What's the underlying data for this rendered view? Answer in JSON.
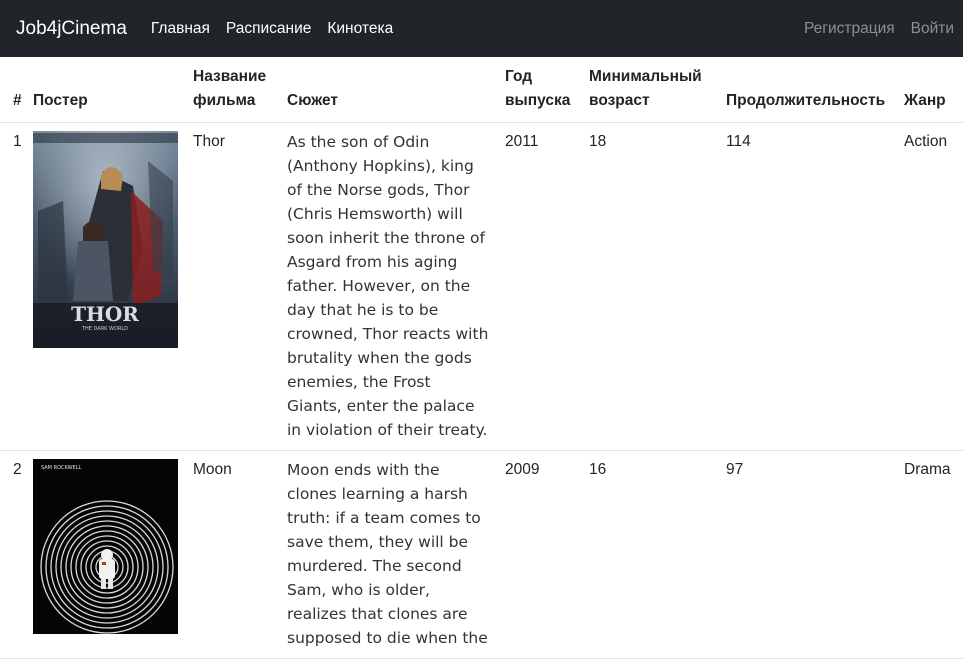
{
  "navbar": {
    "brand": "Job4jCinema",
    "links": [
      "Главная",
      "Расписание",
      "Кинотека"
    ],
    "register": "Регистрация",
    "login": "Войти",
    "bg_color": "#212529"
  },
  "table": {
    "headers": {
      "num": "#",
      "poster": "Постер",
      "title": "Название фильма",
      "plot": "Сюжет",
      "year": "Год выпуска",
      "min_age": "Минимальный возраст",
      "duration": "Продолжительность",
      "genre": "Жанр"
    },
    "rows": [
      {
        "num": "1",
        "poster": "thor-poster",
        "poster_text": "THOR",
        "poster_subtitle": "THE DARK WORLD",
        "title": "Thor",
        "plot": "As the son of Odin (Anthony Hopkins), king of the Norse gods, Thor (Chris Hemsworth) will soon inherit the throne of Asgard from his aging father. However, on the day that he is to be crowned, Thor reacts with brutality when the gods enemies, the Frost Giants, enter the palace in violation of their treaty.",
        "year": "2011",
        "min_age": "18",
        "duration": "114",
        "genre": "Action"
      },
      {
        "num": "2",
        "poster": "moon-poster",
        "poster_text": "SAM ROCKWELL",
        "title": "Moon",
        "plot": "Moon ends with the clones learning a harsh truth: if a team comes to save them, they will be murdered. The second Sam, who is older, realizes that clones are supposed to die when the",
        "year": "2009",
        "min_age": "16",
        "duration": "97",
        "genre": "Drama"
      }
    ]
  }
}
